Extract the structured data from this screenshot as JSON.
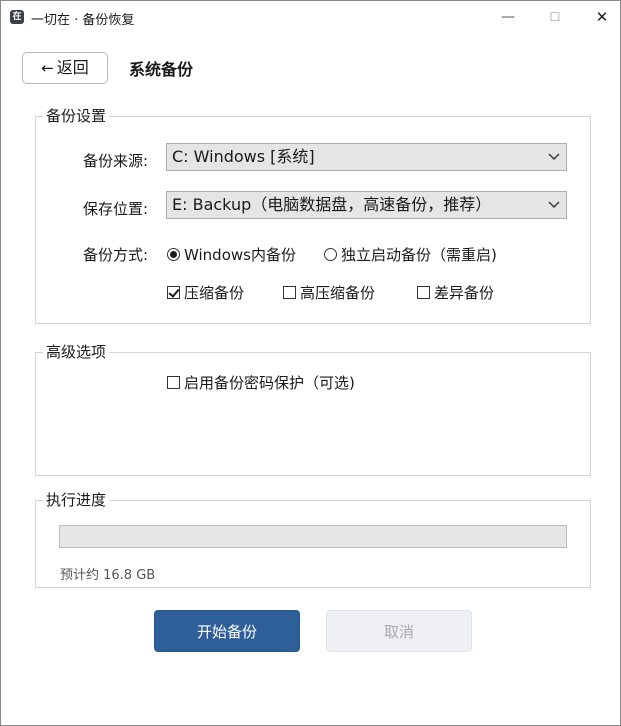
{
  "window": {
    "app_icon": "在",
    "title": "一切在 · 备份恢复",
    "minimize": "—",
    "maximize": "☐",
    "close": "✕"
  },
  "header": {
    "back_label": "返回",
    "back_arrow": "←",
    "page_title": "系统备份"
  },
  "backup_settings": {
    "group_title": "备份设置",
    "source_label": "备份来源:",
    "source_value": "C: Windows [系统]",
    "target_label": "保存位置:",
    "target_value": "E: Backup（电脑数据盘，高速备份，推荐）",
    "method_label": "备份方式:",
    "methods": [
      {
        "label": "Windows内备份",
        "selected": true
      },
      {
        "label": "独立启动备份（需重启)",
        "selected": false
      }
    ],
    "options": [
      {
        "label": "压缩备份",
        "checked": true
      },
      {
        "label": "高压缩备份",
        "checked": false
      },
      {
        "label": "差异备份",
        "checked": false
      }
    ]
  },
  "advanced": {
    "group_title": "高级选项",
    "password_label": "启用备份密码保护（可选)",
    "password_checked": false
  },
  "progress": {
    "group_title": "执行进度",
    "fraction": 0.0,
    "estimate": "预计约 16.8 GB"
  },
  "actions": {
    "start_label": "开始备份",
    "cancel_label": "取消"
  },
  "colors": {
    "accent": "#2f5f99",
    "disabled_bg": "#eef0f3",
    "disabled_text": "#a7abb1"
  }
}
